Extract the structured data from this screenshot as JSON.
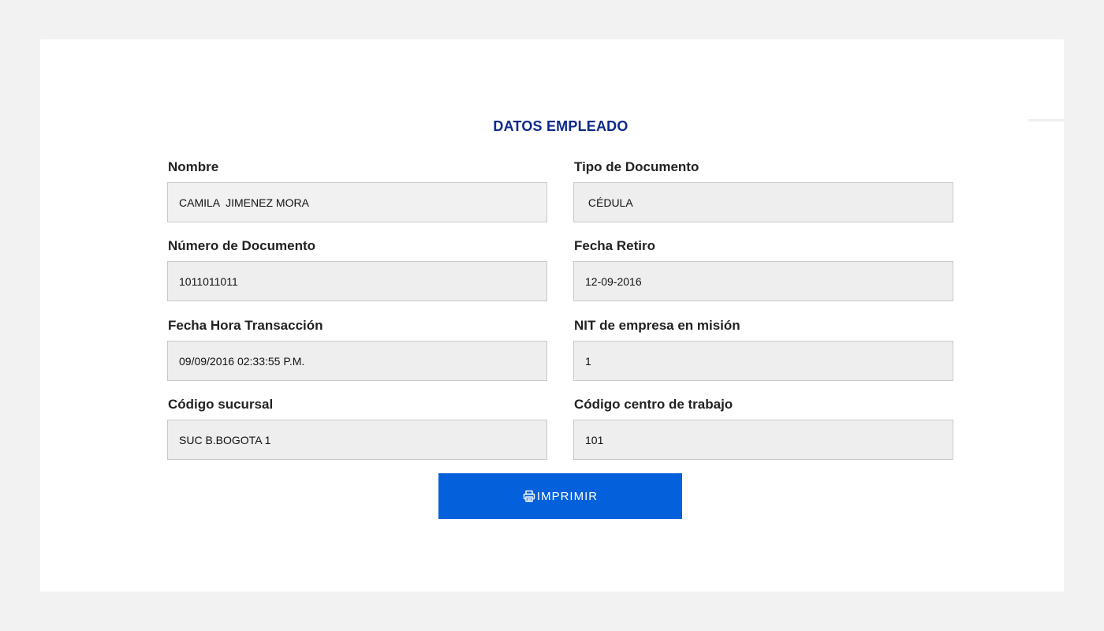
{
  "title": "DATOS EMPLEADO",
  "fields": {
    "nombre": {
      "label": "Nombre",
      "value": "CAMILA  JIMENEZ MORA"
    },
    "tipo_documento": {
      "label": "Tipo de Documento",
      "value": " CÉDULA"
    },
    "numero_documento": {
      "label": "Número de Documento",
      "value": "1011011011"
    },
    "fecha_retiro": {
      "label": "Fecha Retiro",
      "value": "12-09-2016"
    },
    "fecha_hora_transaccion": {
      "label": "Fecha Hora Transacción",
      "value": "09/09/2016 02:33:55 P.M."
    },
    "nit_empresa": {
      "label": "NIT de empresa en misión",
      "value": "1"
    },
    "codigo_sucursal": {
      "label": "Código sucursal",
      "value": "SUC B.BOGOTA 1"
    },
    "codigo_centro_trabajo": {
      "label": "Código centro de trabajo",
      "value": "101"
    }
  },
  "print_button": {
    "label": "IMPRIMIR",
    "icon": "printer-icon"
  },
  "colors": {
    "title": "#0d2a8a",
    "button": "#0560dc",
    "field_bg": "#eeeeee",
    "page_bg": "#f2f2f2"
  }
}
